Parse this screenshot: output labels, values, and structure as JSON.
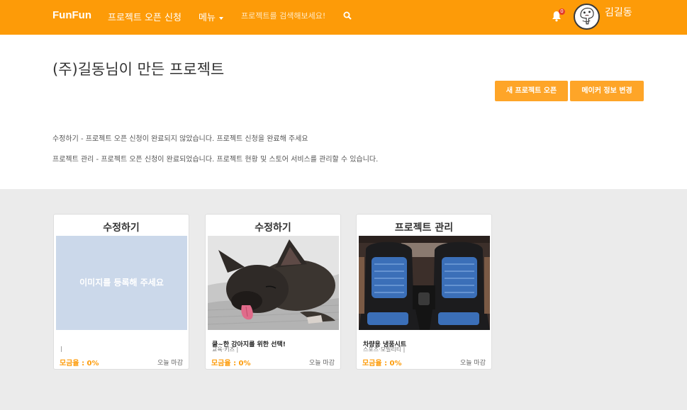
{
  "nav": {
    "brand": "FunFun",
    "open_project": "프로젝트 오픈 신청",
    "menu": "메뉴",
    "search_placeholder": "프로젝트를 검색해보세요!",
    "notification_count": "0",
    "username": "김길동"
  },
  "header": {
    "title": "(주)길동님이 만든 프로젝트",
    "new_project_button": "새 프로젝트 오픈",
    "maker_info_button": "메이커 정보 변경",
    "desc_edit": "수정하기 - 프로젝트 오픈 신청이 완료되지 않았습니다. 프로젝트 신청을 완료해 주세요",
    "desc_manage": "프로젝트 관리 - 프로젝트 오픈 신청이 완료되었습니다. 프로젝트 현황 및 스토어 서비스를 관리할 수 있습니다."
  },
  "cards": [
    {
      "action": "수정하기",
      "image": "placeholder",
      "image_text": "이미지를 등록해 주세요",
      "name": "",
      "category": "|",
      "funding": "모금율 : 0%",
      "deadline": "오늘 마감"
    },
    {
      "action": "수정하기",
      "image": "dog",
      "name": "쿨~한 강아지를 위한 선택!",
      "category": "교육·키즈 |",
      "funding": "모금율 : 0%",
      "deadline": "오늘 마감"
    },
    {
      "action": "프로젝트 관리",
      "image": "car-seat",
      "name": "차량용 냉풍시트",
      "category": "스포츠·모빌리티 |",
      "funding": "모금율 : 0%",
      "deadline": "오늘 마감"
    }
  ],
  "colors": {
    "brand": "#fd9b08",
    "button": "#fea528",
    "placeholder": "#cbd8ea"
  }
}
